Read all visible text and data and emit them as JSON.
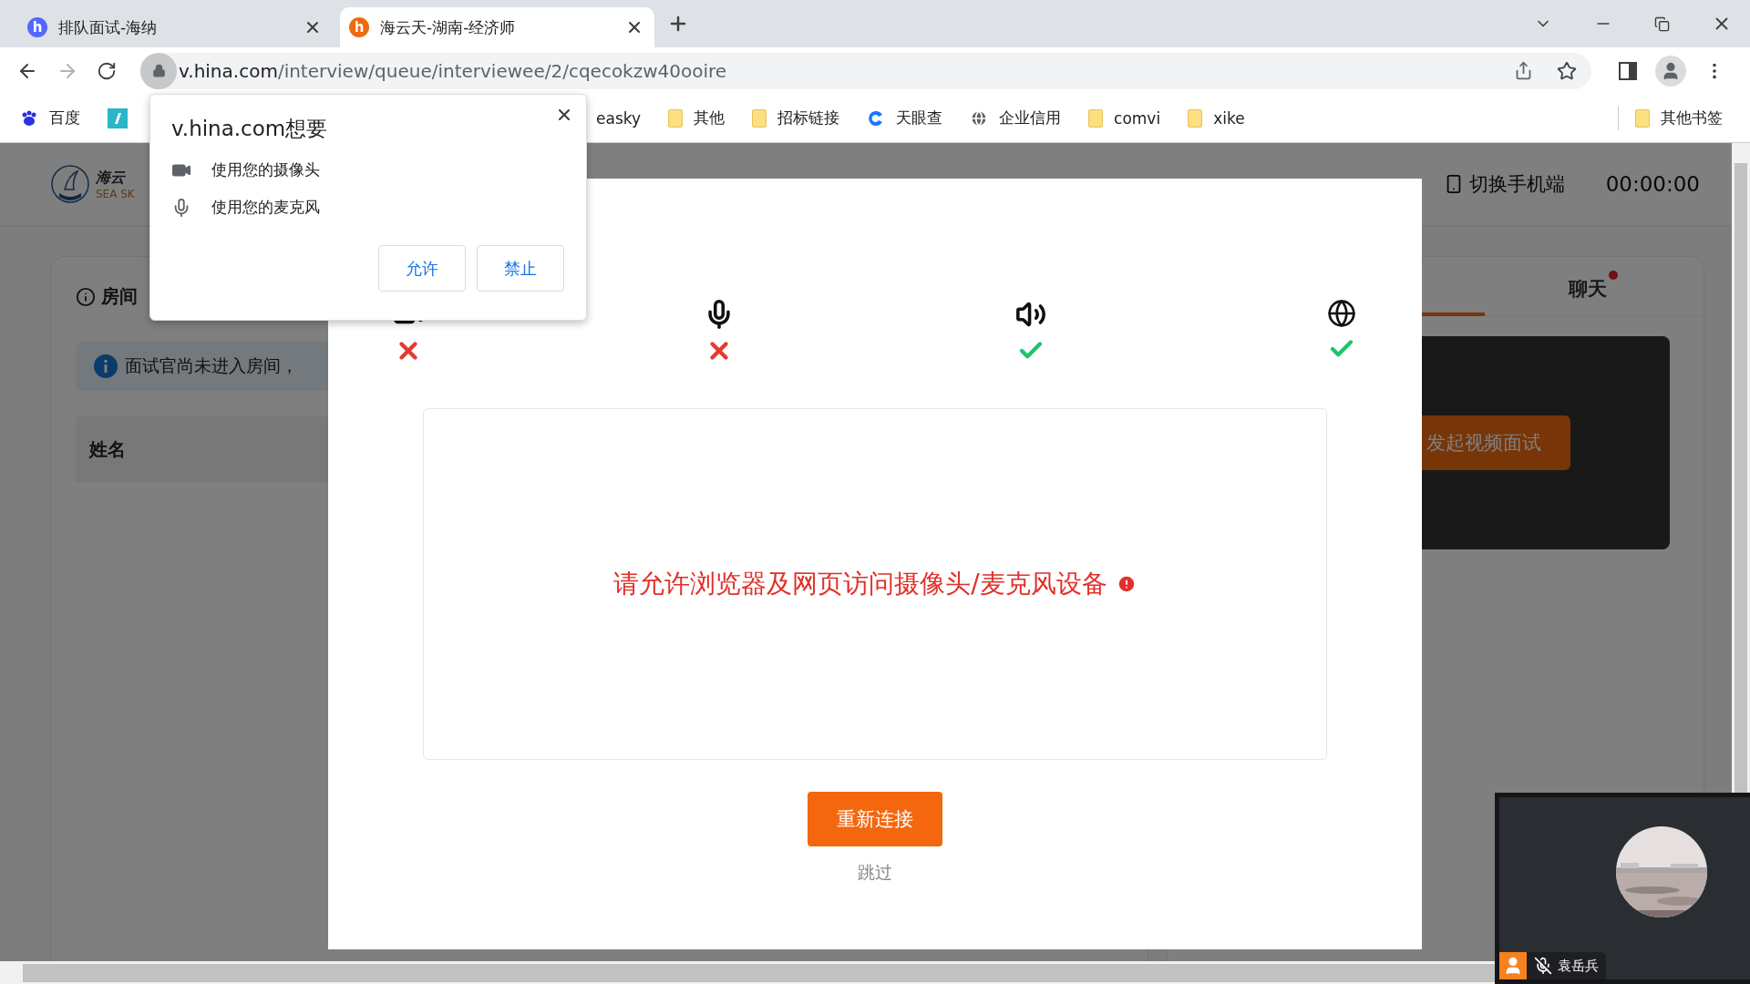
{
  "browser": {
    "tabs": [
      {
        "icon_text": "h",
        "title": "排队面试-海纳",
        "selected": false
      },
      {
        "icon_text": "h",
        "title": "海云天-湖南-经济师",
        "selected": true
      }
    ],
    "address": {
      "host": "v.hina.com",
      "path": "/interview/queue/interviewee/2/cqecokzw40ooire"
    },
    "bookmarks": [
      {
        "kind": "baidu",
        "label": "百度"
      },
      {
        "kind": "teal"
      },
      {
        "kind": "covered",
        "label": "easky"
      },
      {
        "kind": "folder",
        "label": "其他"
      },
      {
        "kind": "folder",
        "label": "招标链接"
      },
      {
        "kind": "tianyancha",
        "label": "天眼查"
      },
      {
        "kind": "globe",
        "label": "企业信用"
      },
      {
        "kind": "folder",
        "label": "comvi"
      },
      {
        "kind": "folder",
        "label": "xike"
      }
    ],
    "other_bookmarks": "其他书签"
  },
  "permission_popup": {
    "title": "v.hina.com想要",
    "items": [
      {
        "kind": "camera",
        "label": "使用您的摄像头"
      },
      {
        "kind": "mic",
        "label": "使用您的麦克风"
      }
    ],
    "buttons": [
      "允许",
      "禁止"
    ]
  },
  "page": {
    "logo": {
      "name": "海云",
      "sub": "SEA SK"
    },
    "switch_label": "切换手机端",
    "timer": "00:00:00",
    "room_card": {
      "title": "房间",
      "notice": "面试官尚未进入房间，",
      "table_header": "姓名"
    },
    "side_tabs": [
      {
        "label": "聊天",
        "unread": true
      }
    ],
    "start_button": "发起视频面试"
  },
  "device_check": {
    "devices": [
      {
        "kind": "camera",
        "ok": false
      },
      {
        "kind": "mic",
        "ok": false
      },
      {
        "kind": "speaker",
        "ok": true
      },
      {
        "kind": "network",
        "ok": true
      }
    ],
    "message": "请允许浏览器及网页访问摄像头/麦克风设备",
    "retry_button": "重新连接",
    "skip_link": "跳过"
  },
  "video_tile": {
    "name": "袁岳兵",
    "muted": true
  }
}
